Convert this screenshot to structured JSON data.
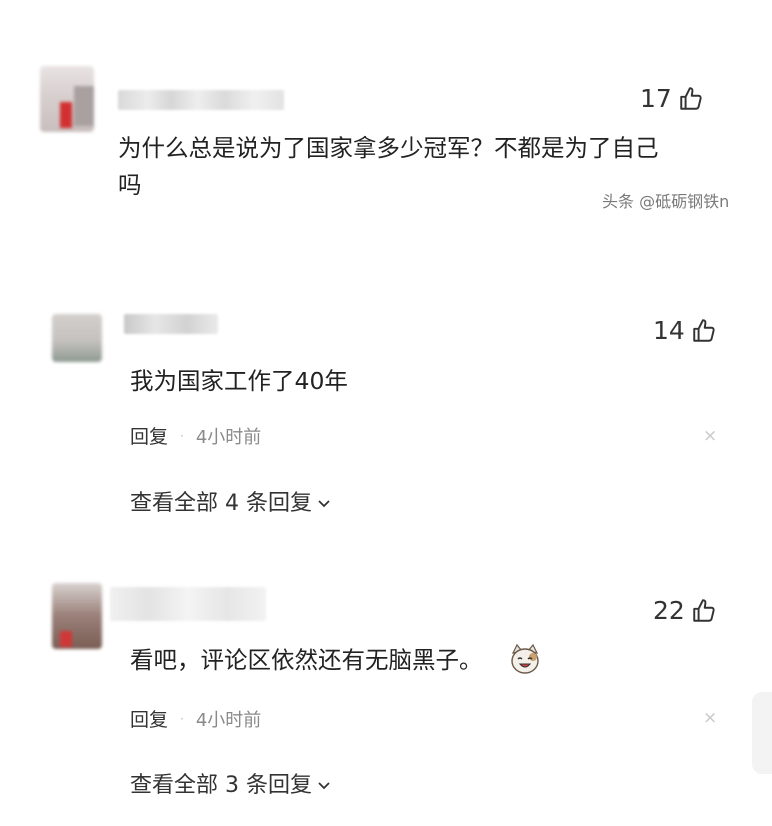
{
  "comments": [
    {
      "likes": "17",
      "text_lines": [
        "为什么总是说为了国家拿多少冠军？不都是为了自己",
        "吗"
      ],
      "watermark": "头条 @砥砺钢铁n"
    },
    {
      "likes": "14",
      "text": "我为国家工作了40年",
      "reply_label": "回复",
      "separator": "·",
      "time": "4小时前",
      "close": "×",
      "view_all": "查看全部 4 条回复"
    },
    {
      "likes": "22",
      "text": "看吧，评论区依然还有无脑黑子。",
      "emoji": "smiling-cat-emoji",
      "reply_label": "回复",
      "separator": "·",
      "time": "4小时前",
      "close": "×",
      "view_all": "查看全部 3 条回复"
    }
  ]
}
